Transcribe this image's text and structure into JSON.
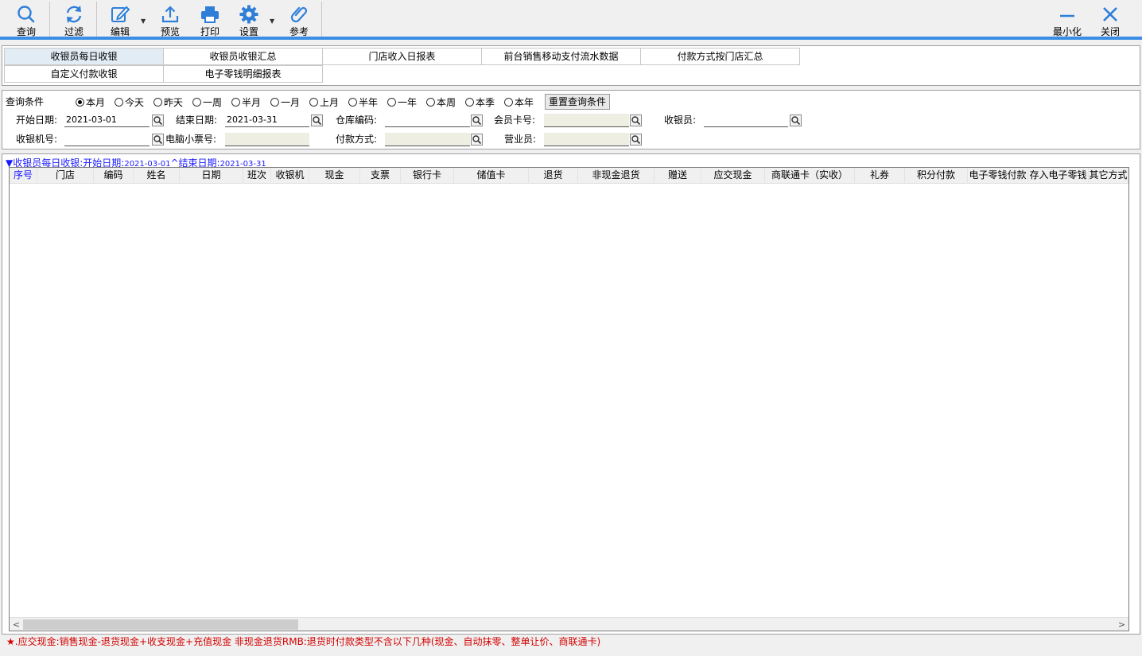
{
  "toolbar": {
    "query": "查询",
    "filter": "过滤",
    "edit": "编辑",
    "preview": "预览",
    "print": "打印",
    "settings": "设置",
    "reference": "参考",
    "minimize": "最小化",
    "close": "关闭",
    "accent_color": "#3a8ee6"
  },
  "tabs": [
    {
      "label": "收银员每日收银",
      "active": true
    },
    {
      "label": "收银员收银汇总"
    },
    {
      "label": "门店收入日报表"
    },
    {
      "label": "前台销售移动支付流水数据"
    },
    {
      "label": "付款方式按门店汇总"
    },
    {
      "label": "自定义付款收银"
    },
    {
      "label": "电子零钱明细报表"
    }
  ],
  "query": {
    "title": "查询条件",
    "ranges": [
      "本月",
      "今天",
      "昨天",
      "一周",
      "半月",
      "一月",
      "上月",
      "半年",
      "一年",
      "本周",
      "本季",
      "本年"
    ],
    "selected_range": "本月",
    "reset_button": "重置查询条件",
    "start_date_label": "开始日期:",
    "start_date": "2021-03-01",
    "end_date_label": "结束日期:",
    "end_date": "2021-03-31",
    "warehouse_label": "仓库编码:",
    "member_label": "会员卡号:",
    "cashier_label": "收银员:",
    "register_label": "收银机号:",
    "ticket_label": "电脑小票号:",
    "payment_label": "付款方式:",
    "sales_label": "营业员:"
  },
  "grid": {
    "caption_prefix": "▼收银员每日收银",
    "caption_start_label": ":开始日期:",
    "caption_start": "2021-03-01",
    "caption_end_label": "^结束日期:",
    "caption_end": "2021-03-31",
    "columns": [
      "序号",
      "门店",
      "编码",
      "姓名",
      "日期",
      "班次",
      "收银机",
      "现金",
      "支票",
      "银行卡",
      "储值卡",
      "退货",
      "非现金退货",
      "赠送",
      "应交现金",
      "商联通卡（实收）",
      "礼券",
      "积分付款",
      "电子零钱付款",
      "存入电子零钱",
      "其它方式"
    ]
  },
  "footnote": {
    "star": "★",
    "text": ".应交现金:销售现金-退货现金+收支现金+充值现金 非现金退货RMB:退货时付款类型不含以下几种(现金、自动抹零、整单让价、商联通卡)",
    "color": "#d40000"
  }
}
